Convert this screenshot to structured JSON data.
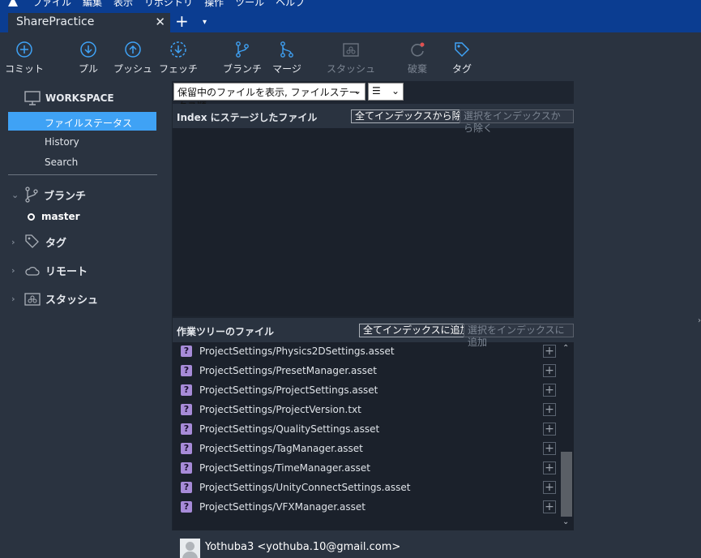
{
  "menu": {
    "items": [
      "ファイル",
      "編集",
      "表示",
      "リポジトリ",
      "操作",
      "ツール",
      "ヘルプ"
    ]
  },
  "tab": {
    "title": "SharePractice",
    "close": "✕",
    "new": "+",
    "dropdown": "▾"
  },
  "toolbar": {
    "commit": "コミット",
    "pull": "プル",
    "push": "プッシュ",
    "fetch": "フェッチ",
    "branch": "ブランチ",
    "merge": "マージ",
    "stash": "スタッシュ",
    "discard": "破棄",
    "tag": "タグ"
  },
  "sidebar": {
    "workspace": "WORKSPACE",
    "items": [
      "ファイルステータス",
      "History",
      "Search"
    ],
    "branches": "ブランチ",
    "branch_master": "master",
    "tags": "タグ",
    "remotes": "リモート",
    "stashes": "スタッシュ"
  },
  "filter": {
    "selected": "保留中のファイルを表示, ファイルステータス順",
    "view": "☰"
  },
  "staged": {
    "title": "Index にステージしたファイル",
    "unstage_all": "全てインデックスから除く",
    "unstage_selected": "選択をインデックスから除く"
  },
  "working": {
    "title": "作業ツリーのファイル",
    "stage_all": "全てインデックスに追加",
    "stage_selected": "選択をインデックスに追加",
    "files": [
      "ProjectSettings/Physics2DSettings.asset",
      "ProjectSettings/PresetManager.asset",
      "ProjectSettings/ProjectSettings.asset",
      "ProjectSettings/ProjectVersion.txt",
      "ProjectSettings/QualitySettings.asset",
      "ProjectSettings/TagManager.asset",
      "ProjectSettings/TimeManager.asset",
      "ProjectSettings/UnityConnectSettings.asset",
      "ProjectSettings/VFXManager.asset"
    ],
    "status_icon": "?",
    "add_icon": "+"
  },
  "commit": {
    "user": "Yothuba3 <yothuba.10@gmail.com>"
  },
  "colors": {
    "accent": "#3fa2f5",
    "titlebar": "#0b3d91",
    "untracked": "#a78bd8"
  }
}
